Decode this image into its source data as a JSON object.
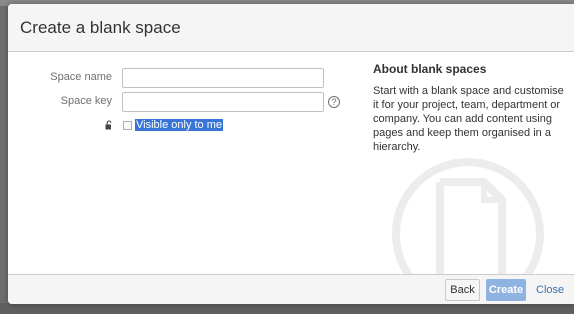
{
  "dialog": {
    "title": "Create a blank space"
  },
  "form": {
    "space_name_label": "Space name",
    "space_name_value": "",
    "space_key_label": "Space key",
    "space_key_value": "",
    "help_glyph": "?",
    "visible_only_label": "Visible only to me",
    "visible_only_checked": false
  },
  "about": {
    "title": "About blank spaces",
    "text": "Start with a blank space and customise it for your project, team, department or company. You can add content using pages and keep them organised in a hierarchy."
  },
  "footer": {
    "back_label": "Back",
    "create_label": "Create",
    "close_label": "Close"
  },
  "icons": {
    "lock": "lock-icon",
    "help": "help-icon",
    "watermark": "blank-page-icon"
  },
  "colors": {
    "highlight": "#3875d7",
    "create_button": "#8eb3e1",
    "link": "#3572b0"
  }
}
